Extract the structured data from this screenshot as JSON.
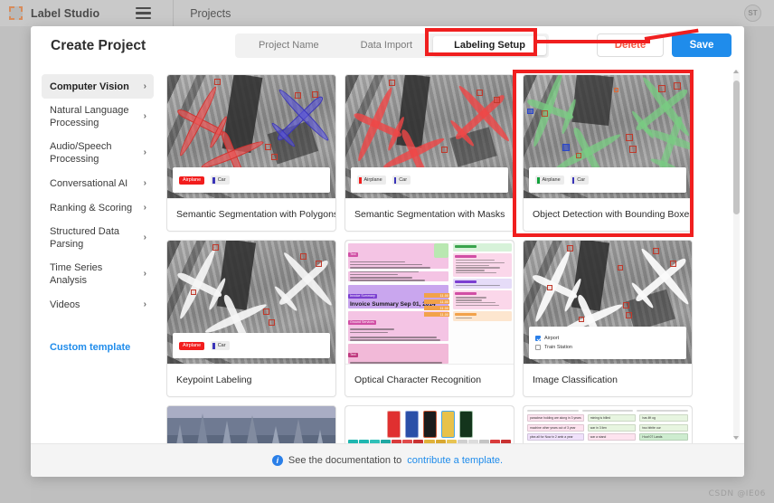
{
  "app": {
    "brand": "Label Studio",
    "logo_icon": "label-studio-logo-icon",
    "menu_icon": "hamburger-menu-icon",
    "nav_projects": "Projects",
    "avatar_initials": "ST"
  },
  "modal": {
    "title": "Create Project",
    "tabs": [
      {
        "label": "Project Name",
        "active": false
      },
      {
        "label": "Data Import",
        "active": false
      },
      {
        "label": "Labeling Setup",
        "active": true
      }
    ],
    "actions": {
      "delete_label": "Delete",
      "save_label": "Save"
    }
  },
  "sidebar": {
    "items": [
      {
        "label": "Computer Vision",
        "active": true,
        "chevron": "›"
      },
      {
        "label": "Natural Language Processing",
        "active": false,
        "chevron": "›"
      },
      {
        "label": "Audio/Speech Processing",
        "active": false,
        "chevron": "›"
      },
      {
        "label": "Conversational AI",
        "active": false,
        "chevron": "›"
      },
      {
        "label": "Ranking & Scoring",
        "active": false,
        "chevron": "›"
      },
      {
        "label": "Structured Data Parsing",
        "active": false,
        "chevron": "›"
      },
      {
        "label": "Time Series Analysis",
        "active": false,
        "chevron": "›"
      },
      {
        "label": "Videos",
        "active": false,
        "chevron": "›"
      }
    ],
    "custom_template": "Custom template"
  },
  "templates": [
    {
      "title": "Semantic Segmentation with Polygons",
      "thumb": "aerial-polygons",
      "selected": false
    },
    {
      "title": "Semantic Segmentation with Masks",
      "thumb": "aerial-masks",
      "selected": false
    },
    {
      "title": "Object Detection with Bounding Boxes",
      "thumb": "aerial-boxes",
      "selected": true
    },
    {
      "title": "Keypoint Labeling",
      "thumb": "aerial-keypoints",
      "selected": false
    },
    {
      "title": "Optical Character Recognition",
      "thumb": "invoice-ocr",
      "selected": false
    },
    {
      "title": "Image Classification",
      "thumb": "aerial-classify",
      "selected": false
    },
    {
      "title": "",
      "thumb": "snow-forest",
      "selected": false
    },
    {
      "title": "",
      "thumb": "beverages",
      "selected": false
    },
    {
      "title": "",
      "thumb": "text-tags",
      "selected": false
    }
  ],
  "legend": {
    "airplane": "Airplane",
    "car": "Car"
  },
  "classification": {
    "airport": "Airport",
    "train_station": "Train Station"
  },
  "ocr_preview": {
    "heading": "Invoice Summary Sep 01, 2014",
    "lines": [
      "I R I S INC",
      "DELRAY BEACH FL 33445-3897",
      "Billing Account Shipping Address",
      "4701 W ATLANTIC AVE",
      "DELRAY BEACH FL 33445-3897 US",
      "Ground Services",
      "Other Charges",
      "Total Charges .................... USD $",
      "TOTAL THIS INVOICE ........ USD $",
      "The only charges accrued for this period is the Weekly Service Charge."
    ],
    "amounts": [
      "11.00",
      "11.00",
      "11.00",
      "11.00"
    ]
  },
  "footer": {
    "text": "See the documentation to",
    "link": "contribute a template.",
    "info_icon": "info-icon"
  },
  "watermark": "CSDN @IE06",
  "colors": {
    "accent_blue": "#1f8ceb",
    "danger_red": "#f5543f",
    "annotation_red": "#f01f1f",
    "logo_orange": "#d88b5a"
  }
}
